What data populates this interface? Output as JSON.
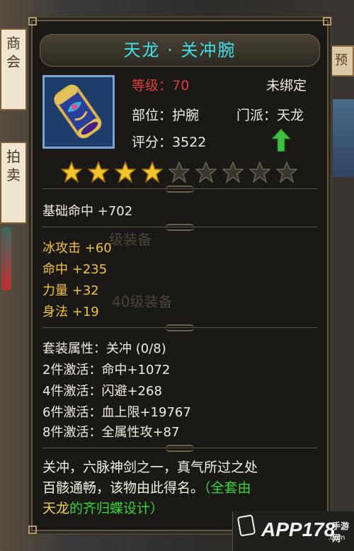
{
  "background": {
    "sign_top": "商\n会",
    "sign_bottom": "拍\n卖",
    "right_button": "预"
  },
  "item": {
    "name": "天龙 · 关冲腕",
    "level_label": "等级：",
    "level_value": "70",
    "bind_status": "未绑定",
    "slot": "部位：护腕",
    "school": "门派：天龙",
    "score_label": "评分：",
    "score_value": "3522",
    "stars_filled": 4,
    "stars_total": 9
  },
  "base_attr": {
    "name": "基础命中",
    "value": "+702"
  },
  "extra_attrs": [
    {
      "name": "冰攻击",
      "value": "+60"
    },
    {
      "name": "命中",
      "value": "+235"
    },
    {
      "name": "力量",
      "value": "+32"
    },
    {
      "name": "身法",
      "value": "+19"
    }
  ],
  "ghost_text": [
    "级装备",
    "40级装备"
  ],
  "set": {
    "header": "套装属性：关冲",
    "progress": "(0/8)",
    "bonuses": [
      "2件激活：命中+1072",
      "4件激活：闪避+268",
      "6件激活：血上限+19767",
      "8件激活：全属性攻+87"
    ]
  },
  "description": {
    "line1": "关冲，六脉神剑之一，真气所过之处",
    "line2_white": "百骸通畅，该物由此得名。",
    "line2_green": "（全套由",
    "line3_yellow": "天龙",
    "line3_green": "的齐归蝶设计）"
  },
  "watermark": {
    "text": "APP178",
    "sub": "手游网",
    "domain": ".com"
  },
  "colors": {
    "title": "#3fe0e8",
    "level": "#e23b3b",
    "attr_gold": "#f2c13a",
    "green": "#36d83a"
  }
}
